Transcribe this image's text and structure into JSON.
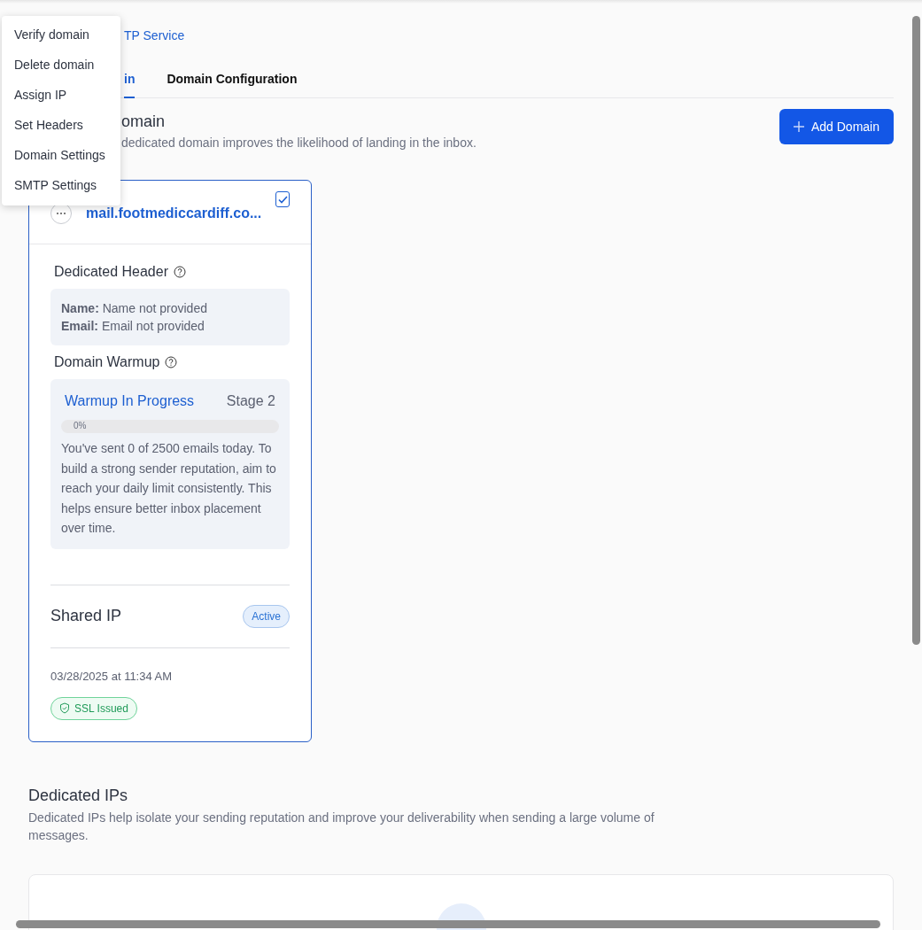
{
  "menu": {
    "items": [
      "Verify domain",
      "Delete domain",
      "Assign IP",
      "Set Headers",
      "Domain Settings",
      "SMTP Settings"
    ]
  },
  "breadcrumb": "TP Service",
  "tabs": [
    {
      "label": "in",
      "selected": true
    },
    {
      "label": "Domain Configuration",
      "selected": false
    }
  ],
  "section": {
    "title": "omain",
    "subtitle": "dedicated domain improves the likelihood of landing in the inbox.",
    "add_button": "Add Domain"
  },
  "domain_card": {
    "domain": "mail.footmediccardiff.co...",
    "checked": true,
    "header_title": "Dedicated Header",
    "header_name_label": "Name:",
    "header_name": "Name not provided",
    "header_email_label": "Email:",
    "header_email": "Email not provided",
    "warmup_title": "Domain Warmup",
    "warmup_status": "Warmup In Progress",
    "warmup_stage": "Stage 2",
    "warmup_progress": {
      "level": 0,
      "reading": "0%"
    },
    "warmup_text": "You've sent 0 of 2500 emails today. To build a strong sender reputation, aim to reach your daily limit consistently. This helps ensure better inbox placement over time.",
    "ip_label": "Shared IP",
    "ip_status": "Active",
    "date": "03/28/2025 at 11:34 AM",
    "ssl": "SSL Issued"
  },
  "dedicated_ips": {
    "title": "Dedicated IPs",
    "text": "Dedicated IPs help isolate your sending reputation and improve your deliverability when sending a large volume of messages."
  }
}
